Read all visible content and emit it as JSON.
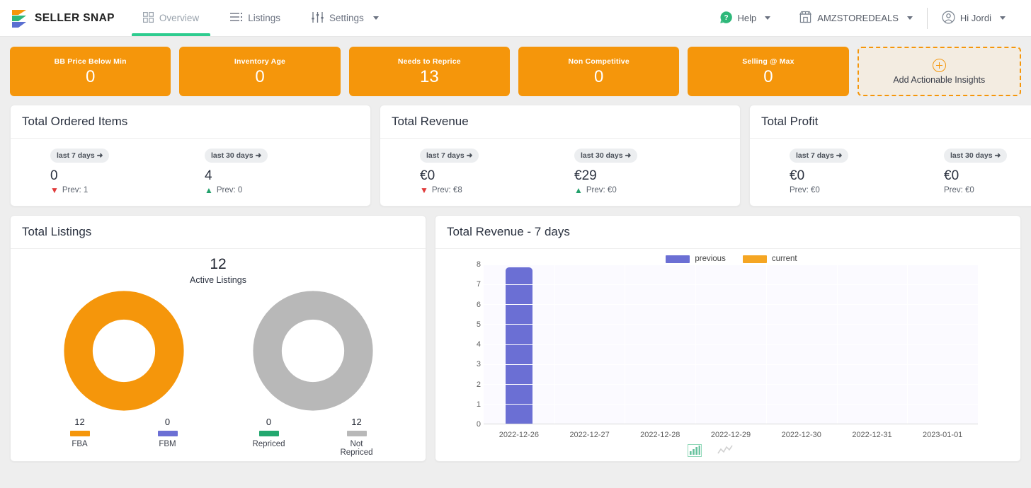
{
  "header": {
    "brand": "SELLER SNAP",
    "nav": [
      {
        "label": "Overview",
        "icon": "grid-icon",
        "active": true
      },
      {
        "label": "Listings",
        "icon": "list-icon",
        "active": false
      },
      {
        "label": "Settings",
        "icon": "sliders-icon",
        "active": false
      }
    ],
    "right": [
      {
        "label": "Help",
        "icon": "help-icon"
      },
      {
        "label": "AMZSTOREDEALS",
        "icon": "store-icon"
      },
      {
        "label": "Hi Jordi",
        "icon": "user-icon"
      }
    ]
  },
  "kpis": [
    {
      "label": "BB Price Below Min",
      "value": "0"
    },
    {
      "label": "Inventory Age",
      "value": "0"
    },
    {
      "label": "Needs to Reprice",
      "value": "13"
    },
    {
      "label": "Non Competitive",
      "value": "0"
    },
    {
      "label": "Selling @ Max",
      "value": "0"
    }
  ],
  "add_insights": {
    "label": "Add Actionable Insights",
    "icon": "plus-circle-icon"
  },
  "stat_cards": [
    {
      "title": "Total Ordered Items",
      "cols": [
        {
          "chip": "last 7 days ➜",
          "value": "0",
          "prev": "Prev: 1",
          "trend": "down"
        },
        {
          "chip": "last 30 days ➜",
          "value": "4",
          "prev": "Prev: 0",
          "trend": "up"
        }
      ]
    },
    {
      "title": "Total Revenue",
      "cols": [
        {
          "chip": "last 7 days ➜",
          "value": "€0",
          "prev": "Prev: €8",
          "trend": "down"
        },
        {
          "chip": "last 30 days ➜",
          "value": "€29",
          "prev": "Prev: €0",
          "trend": "up"
        }
      ]
    },
    {
      "title": "Total Profit",
      "cols": [
        {
          "chip": "last 7 days ➜",
          "value": "€0",
          "prev": "Prev: €0",
          "trend": "none"
        },
        {
          "chip": "last 30 days ➜",
          "value": "€0",
          "prev": "Prev: €0",
          "trend": "none"
        }
      ]
    }
  ],
  "listings": {
    "title": "Total Listings",
    "active_count": "12",
    "active_label": "Active Listings",
    "donut_left": {
      "segments": [
        {
          "label": "FBA",
          "value": "12",
          "color": "#f5960b"
        },
        {
          "label": "FBM",
          "value": "0",
          "color": "#6b6fd4"
        }
      ]
    },
    "donut_right": {
      "segments": [
        {
          "label": "Repriced",
          "value": "0",
          "color": "#23a86f"
        },
        {
          "label": "Not Repriced",
          "value": "12",
          "color": "#b8b8b8"
        }
      ]
    }
  },
  "revenue_chart": {
    "title": "Total Revenue - 7 days"
  },
  "chart_data": {
    "type": "bar",
    "title": "Total Revenue - 7 days",
    "categories": [
      "2022-12-26",
      "2022-12-27",
      "2022-12-28",
      "2022-12-29",
      "2022-12-30",
      "2022-12-31",
      "2023-01-01"
    ],
    "series": [
      {
        "name": "previous",
        "color": "#6b6fd4",
        "values": [
          7.85,
          0,
          0,
          0,
          0,
          0,
          0
        ]
      },
      {
        "name": "current",
        "color": "#f5a623",
        "values": [
          0,
          0,
          0,
          0,
          0,
          0,
          0
        ]
      }
    ],
    "yticks": [
      0,
      1,
      2,
      3,
      4,
      5,
      6,
      7,
      8
    ],
    "ylim": [
      0,
      8
    ],
    "xlabel": "",
    "ylabel": "",
    "grid": true,
    "legend": [
      "previous",
      "current"
    ],
    "legend_position": "top-right"
  },
  "chart_tools": [
    {
      "icon": "bar-chart-icon",
      "active": true
    },
    {
      "icon": "line-chart-icon",
      "active": false
    }
  ]
}
